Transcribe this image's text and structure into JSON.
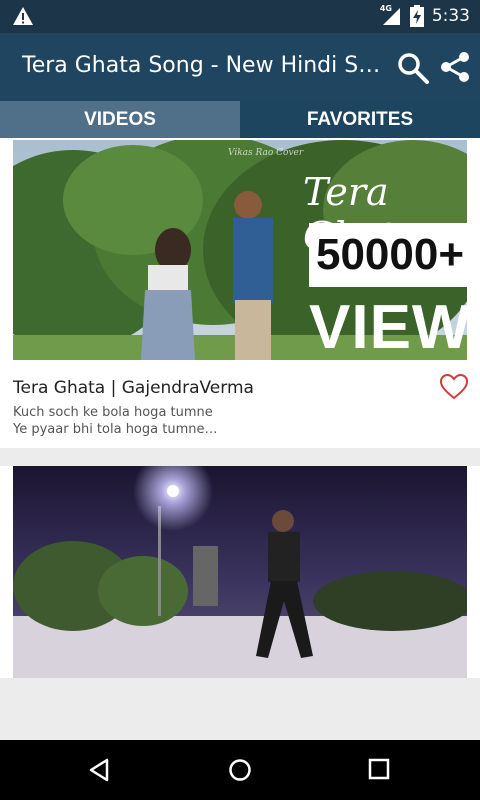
{
  "status_bar": {
    "time": "5:33",
    "network": "4G"
  },
  "app_bar": {
    "title": "Tera Ghata Song - New Hindi Songs"
  },
  "tabs": [
    {
      "label": "VIDEOS",
      "active": true
    },
    {
      "label": "FAVORITES",
      "active": false
    }
  ],
  "videos": [
    {
      "title": "Tera Ghata | GajendraVerma",
      "desc_line1": "Kuch soch ke bola hoga tumne",
      "desc_line2": "Ye pyaar bhi tola hoga tumne…",
      "thumb_title": "Tera Ghata",
      "thumb_count": "50000+",
      "thumb_views": "VIEWS",
      "watermark": "Vikas Rao Cover"
    },
    {
      "title": "",
      "desc_line1": "",
      "desc_line2": ""
    }
  ],
  "colors": {
    "app_bar": "#1f4560",
    "status_bar": "#1d3548",
    "tab_active": "#50708a",
    "heart": "#d33a3a"
  },
  "icons": {
    "warning": "warning-icon",
    "search": "search-icon",
    "share": "share-icon",
    "heart": "heart-outline-icon"
  }
}
